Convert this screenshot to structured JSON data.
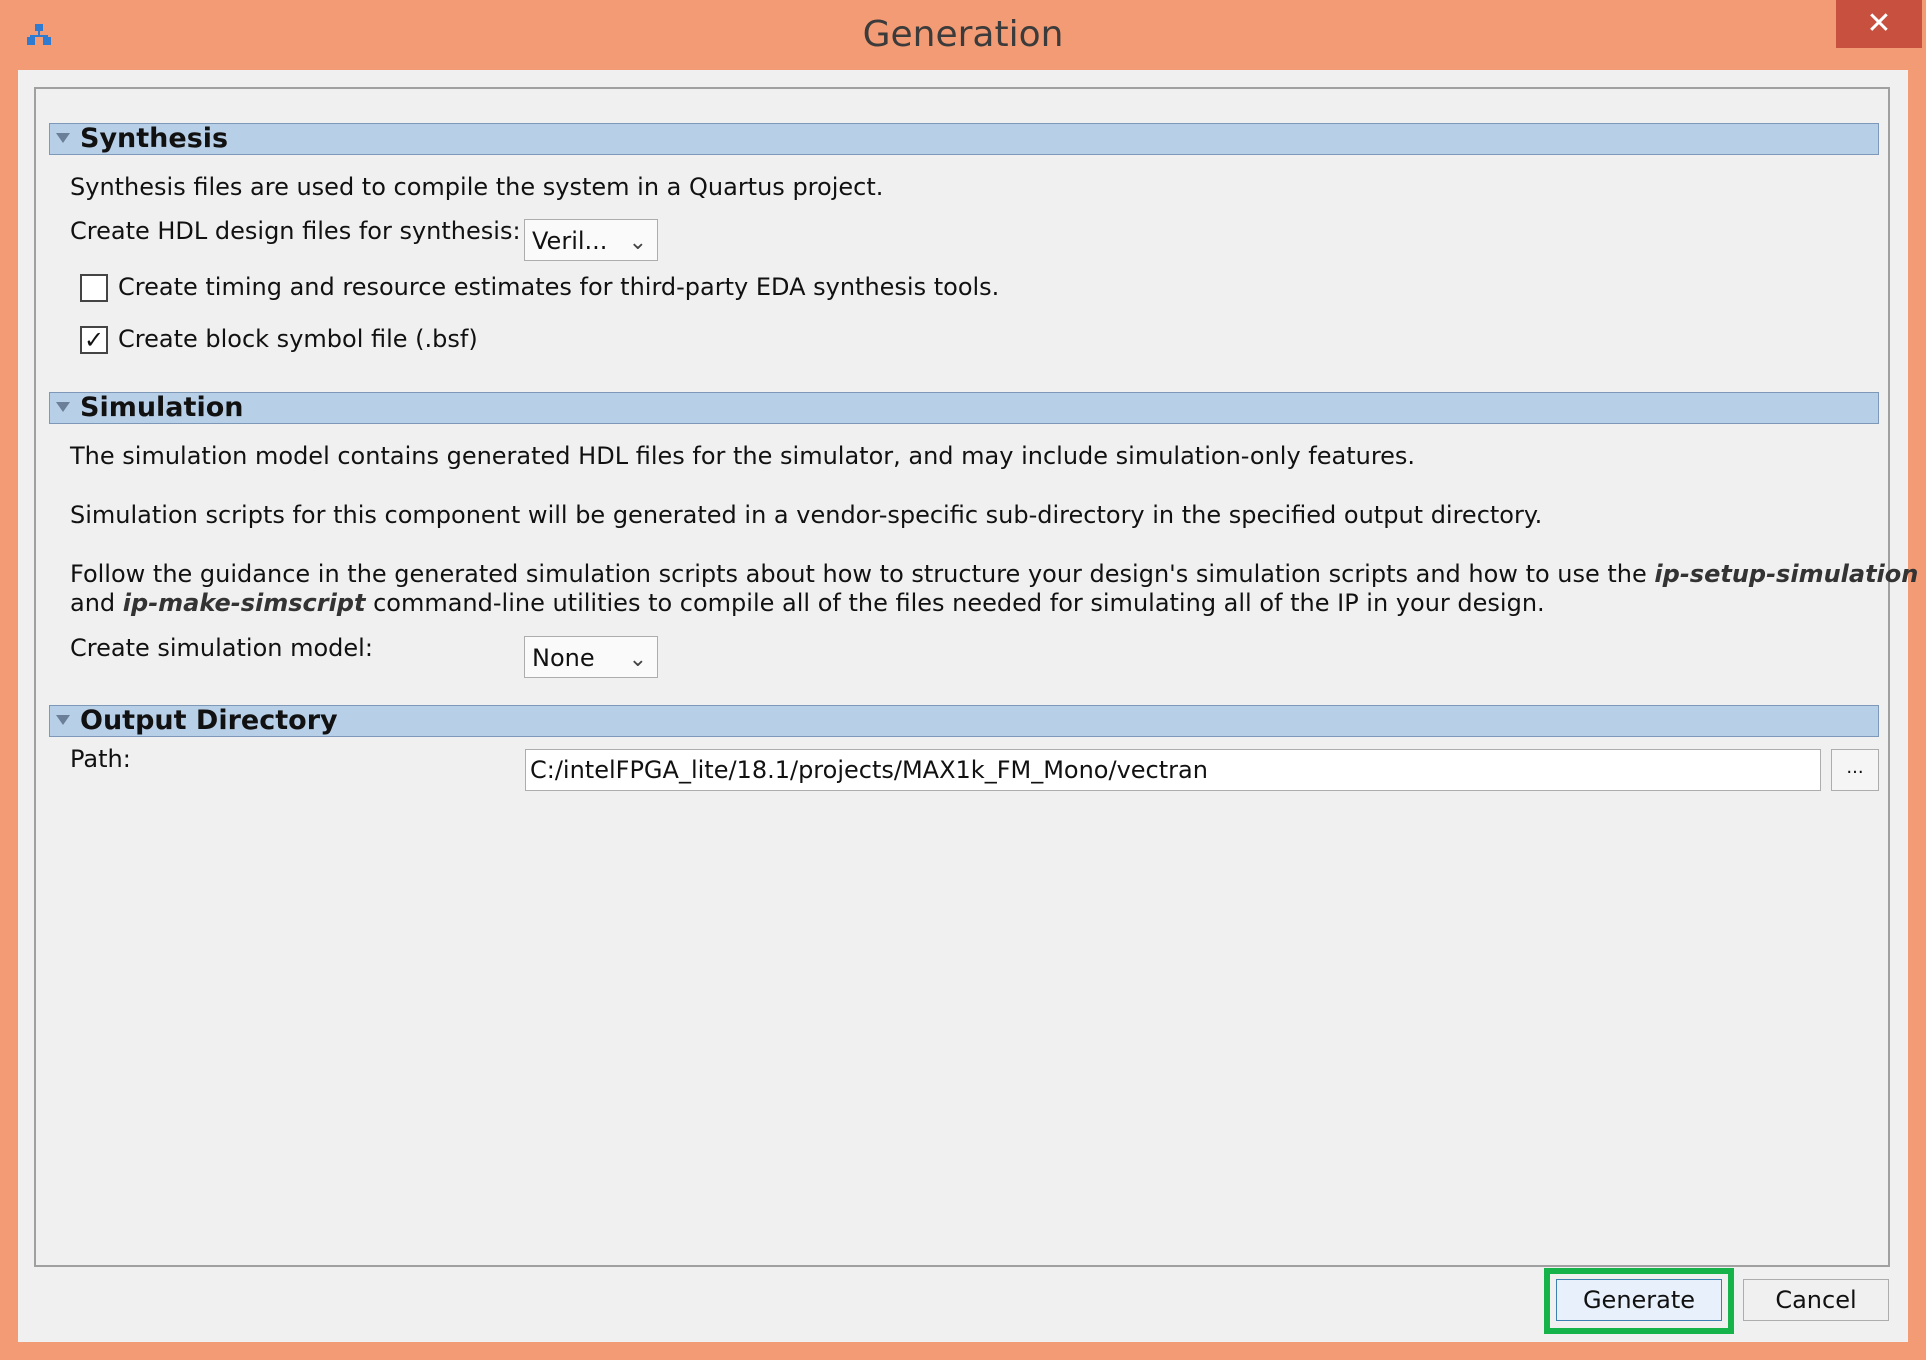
{
  "window": {
    "title": "Generation",
    "close_label": "✕"
  },
  "synthesis": {
    "header": "Synthesis",
    "description": "Synthesis files are used to compile the system in a Quartus project.",
    "hdl_label": "Create HDL design files for synthesis:",
    "hdl_value": "Veril...",
    "timing_checkbox_label": "Create timing and resource estimates for third-party EDA synthesis tools.",
    "timing_checked": false,
    "bsf_checkbox_label": "Create block symbol file (.bsf)",
    "bsf_checked": true
  },
  "simulation": {
    "header": "Simulation",
    "line1": "The simulation model contains generated HDL files for the simulator, and may include simulation-only features.",
    "line2": "Simulation scripts for this component will be generated in a vendor-specific sub-directory in the specified output directory.",
    "line3_pre": "Follow the guidance in the generated simulation scripts about how to structure your design's simulation scripts and how to use the ",
    "line3_em": "ip-setup-simulation",
    "line4_pre": "and ",
    "line4_em": "ip-make-simscript",
    "line4_post": " command-line utilities to compile all of the files needed for simulating all of the IP in your design.",
    "model_label": "Create simulation model:",
    "model_value": "None"
  },
  "output": {
    "header": "Output Directory",
    "path_label": "Path:",
    "path_value": "C:/intelFPGA_lite/18.1/projects/MAX1k_FM_Mono/vectran",
    "browse_label": "..."
  },
  "buttons": {
    "generate": "Generate",
    "cancel": "Cancel"
  },
  "colors": {
    "window_frame": "#f39b74",
    "section_header": "#b8cfe8",
    "highlight": "#15b34a"
  }
}
